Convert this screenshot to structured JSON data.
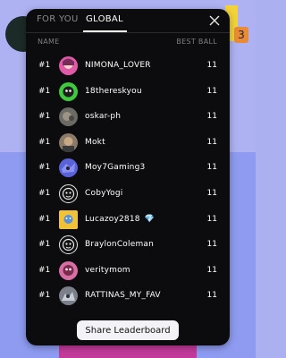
{
  "tabs": [
    {
      "label": "FOR YOU",
      "active": false
    },
    {
      "label": "GLOBAL",
      "active": true
    }
  ],
  "close_icon": "close-icon",
  "columns": {
    "name": "NAME",
    "best": "BEST BALL"
  },
  "rows": [
    {
      "rank": "#1",
      "name": "NIMONA_LOVER",
      "score": "11",
      "avatar_color": "#e05aa8"
    },
    {
      "rank": "#1",
      "name": "18thereskyou",
      "score": "11",
      "avatar_color": "#3ec93e"
    },
    {
      "rank": "#1",
      "name": "oskar-ph",
      "score": "11",
      "avatar_color": "#6b6a65"
    },
    {
      "rank": "#1",
      "name": "Mokt",
      "score": "11",
      "avatar_color": "#8a7a6a"
    },
    {
      "rank": "#1",
      "name": "Moy7Gaming3",
      "score": "11",
      "avatar_color": "#5a62d8"
    },
    {
      "rank": "#1",
      "name": "CobyYogi",
      "score": "11",
      "avatar_color": "#e8e8e8"
    },
    {
      "rank": "#1",
      "name": "Lucazoy2818",
      "score": "11",
      "avatar_color": "#f0c23a",
      "badge_icon": "diamond-icon"
    },
    {
      "rank": "#1",
      "name": "BraylonColeman",
      "score": "11",
      "avatar_color": "#e8e8e8"
    },
    {
      "rank": "#1",
      "name": "veritymom",
      "score": "11",
      "avatar_color": "#d86fa4"
    },
    {
      "rank": "#1",
      "name": "RATTINAS_MY_FAV",
      "score": "11",
      "avatar_color": "#7a7f8a"
    }
  ],
  "share_button": "Share Leaderboard",
  "colors": {
    "panel": "#0c0c0e",
    "text": "#ffffff",
    "muted": "#7d7d83",
    "button": "#f3f3f7"
  }
}
